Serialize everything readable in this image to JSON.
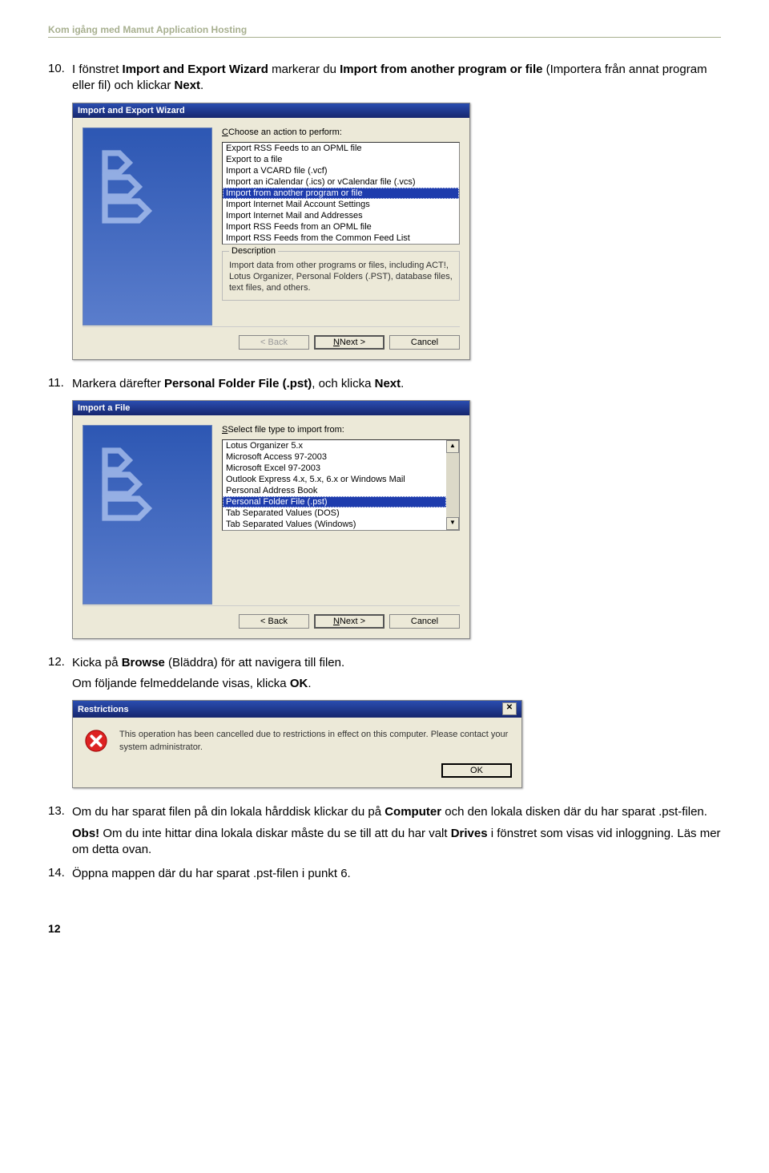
{
  "doc_header": "Kom igång med Mamut Application Hosting",
  "step10_num": "10.",
  "step10_text_1": "I fönstret ",
  "step10_bold_1": "Import and Export Wizard",
  "step10_text_2": " markerar du ",
  "step10_bold_2": "Import from another program or file",
  "step10_text_3": " (Importera från annat program eller fil) och klickar ",
  "step10_bold_3": "Next",
  "step10_text_4": ".",
  "dlg1": {
    "title": "Import and Export Wizard",
    "action_label": "Choose an action to perform:",
    "items": [
      "Export RSS Feeds to an OPML file",
      "Export to a file",
      "Import a VCARD file (.vcf)",
      "Import an iCalendar (.ics) or vCalendar file (.vcs)",
      "Import from another program or file",
      "Import Internet Mail Account Settings",
      "Import Internet Mail and Addresses",
      "Import RSS Feeds from an OPML file",
      "Import RSS Feeds from the Common Feed List"
    ],
    "selected_index": 4,
    "desc_label": "Description",
    "desc_text": "Import data from other programs or files, including ACT!, Lotus Organizer, Personal Folders (.PST), database files, text files, and others.",
    "back": "< Back",
    "next": "Next >",
    "cancel": "Cancel"
  },
  "step11_num": "11.",
  "step11_text_1": "Markera därefter ",
  "step11_bold_1": "Personal Folder File (.pst)",
  "step11_text_2": ", och klicka ",
  "step11_bold_2": "Next",
  "step11_text_3": ".",
  "dlg2": {
    "title": "Import a File",
    "select_label": "Select file type to import from:",
    "items": [
      "Lotus Organizer 5.x",
      "Microsoft Access 97-2003",
      "Microsoft Excel 97-2003",
      "Outlook Express 4.x, 5.x, 6.x or Windows Mail",
      "Personal Address Book",
      "Personal Folder File (.pst)",
      "Tab Separated Values (DOS)",
      "Tab Separated Values (Windows)"
    ],
    "selected_index": 5,
    "back": "< Back",
    "next": "Next >",
    "cancel": "Cancel"
  },
  "step12_num": "12.",
  "step12_text_1": "Kicka på ",
  "step12_bold_1": "Browse",
  "step12_text_2": " (Bläddra) för att navigera till filen.",
  "step12_indent_1": "Om följande felmeddelande visas, klicka ",
  "step12_indent_bold": "OK",
  "step12_indent_2": ".",
  "dlg3": {
    "title": "Restrictions",
    "text": "This operation has been cancelled due to restrictions in effect on this computer. Please contact your system administrator.",
    "ok": "OK"
  },
  "step13_num": "13.",
  "step13_text_1": "Om du har sparat filen på din lokala hårddisk klickar du på ",
  "step13_bold_1": "Computer",
  "step13_text_2": " och den lokala disken där du har sparat .pst-filen.",
  "step13_obs_bold": "Obs!",
  "step13_obs_1": " Om du inte hittar dina lokala diskar måste du se till att du har valt ",
  "step13_obs_bold2": "Drives",
  "step13_obs_2": " i fönstret som visas vid inloggning. Läs mer om detta ovan.",
  "step14_num": "14.",
  "step14_text": "Öppna mappen där du har sparat .pst-filen i punkt 6.",
  "page_number": "12"
}
